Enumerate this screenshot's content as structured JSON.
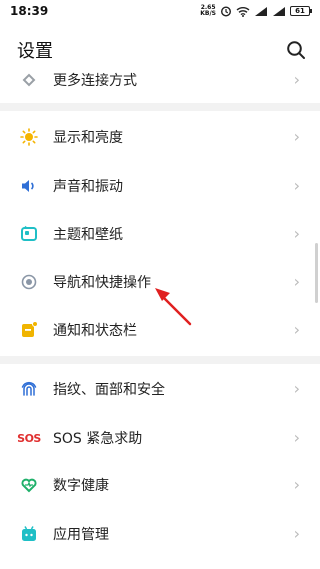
{
  "status": {
    "time": "18:39",
    "net_speed_value": "2.65",
    "net_speed_unit": "KB/S",
    "battery": "61"
  },
  "header": {
    "title": "设置",
    "search_icon": "search-icon"
  },
  "items": [
    {
      "label": "更多连接方式",
      "icon": "link-icon",
      "color": "#9aa0a6"
    },
    {
      "label": "显示和亮度",
      "icon": "sun-icon",
      "color": "#f5b400"
    },
    {
      "label": "声音和振动",
      "icon": "speaker-icon",
      "color": "#2f6fd6"
    },
    {
      "label": "主题和壁纸",
      "icon": "theme-icon",
      "color": "#1fbfc6"
    },
    {
      "label": "导航和快捷操作",
      "icon": "navigation-icon",
      "color": "#8a96a6"
    },
    {
      "label": "通知和状态栏",
      "icon": "notification-icon",
      "color": "#f0b400"
    },
    {
      "label": "指纹、面部和安全",
      "icon": "fingerprint-icon",
      "color": "#2f6fd6"
    },
    {
      "label": "SOS 紧急求助",
      "icon": "sos-icon",
      "icon_text": "SOS",
      "color": "#e03030"
    },
    {
      "label": "数字健康",
      "icon": "heart-icon",
      "color": "#1fb06a"
    },
    {
      "label": "应用管理",
      "icon": "app-icon",
      "color": "#1fbfc6"
    }
  ],
  "chevron": "›"
}
